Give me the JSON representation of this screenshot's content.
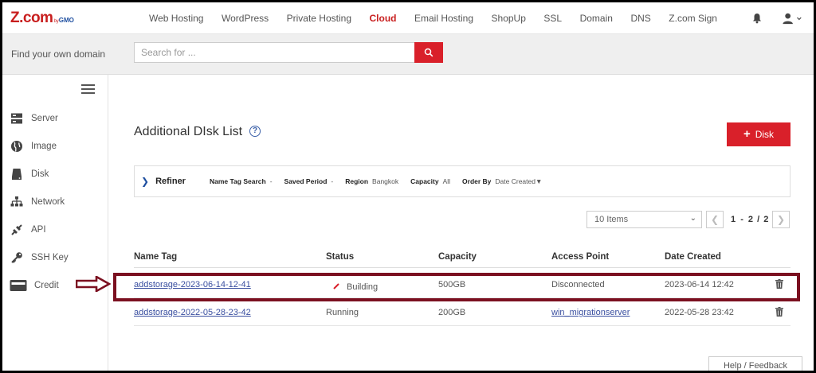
{
  "logo": {
    "main": "Z.com",
    "by": "by",
    "gmo": "GMO"
  },
  "nav": [
    {
      "label": "Web Hosting",
      "active": false
    },
    {
      "label": "WordPress",
      "active": false
    },
    {
      "label": "Private Hosting",
      "active": false
    },
    {
      "label": "Cloud",
      "active": true
    },
    {
      "label": "Email Hosting",
      "active": false
    },
    {
      "label": "ShopUp",
      "active": false
    },
    {
      "label": "SSL",
      "active": false
    },
    {
      "label": "Domain",
      "active": false
    },
    {
      "label": "DNS",
      "active": false
    },
    {
      "label": "Z.com Sign",
      "active": false
    }
  ],
  "search": {
    "label": "Find your own domain",
    "placeholder": "Search for ..."
  },
  "sidebar": {
    "items": [
      {
        "label": "Server",
        "icon": "server-icon"
      },
      {
        "label": "Image",
        "icon": "globe-icon"
      },
      {
        "label": "Disk",
        "icon": "disk-icon"
      },
      {
        "label": "Network",
        "icon": "network-icon"
      },
      {
        "label": "API",
        "icon": "api-icon"
      },
      {
        "label": "SSH Key",
        "icon": "key-icon"
      },
      {
        "label": "Credit",
        "icon": "credit-card-icon"
      }
    ]
  },
  "page": {
    "title": "Additional DIsk List",
    "help": "?",
    "add_button": "Disk"
  },
  "refiner": {
    "label": "Refiner",
    "filters": [
      {
        "key": "Name Tag Search",
        "value": "-"
      },
      {
        "key": "Saved Period",
        "value": "-"
      },
      {
        "key": "Region",
        "value": "Bangkok"
      },
      {
        "key": "Capacity",
        "value": "All"
      },
      {
        "key": "Order By",
        "value": "Date Created▼"
      }
    ]
  },
  "pagination": {
    "items_per_page": "10 Items",
    "current": "1",
    "sep": "-",
    "display": "2",
    "total": "2",
    "prev": "❮",
    "next": "❯"
  },
  "table": {
    "headers": [
      "Name Tag",
      "Status",
      "Capacity",
      "Access Point",
      "Date Created"
    ],
    "rows": [
      {
        "name": "addstorage-2023-06-14-12-41",
        "status": "Building",
        "capacity": "500GB",
        "access_point": "Disconnected",
        "date": "2023-06-14 12:42"
      },
      {
        "name": "addstorage-2022-05-28-23-42",
        "status": "Running",
        "capacity": "200GB",
        "access_point": "win_migrationserver",
        "date": "2022-05-28 23:42"
      }
    ]
  },
  "help_feedback": "Help / Feedback",
  "colors": {
    "brand_red": "#d9202a",
    "highlight": "#7b1020",
    "link": "#3a4fa0"
  }
}
